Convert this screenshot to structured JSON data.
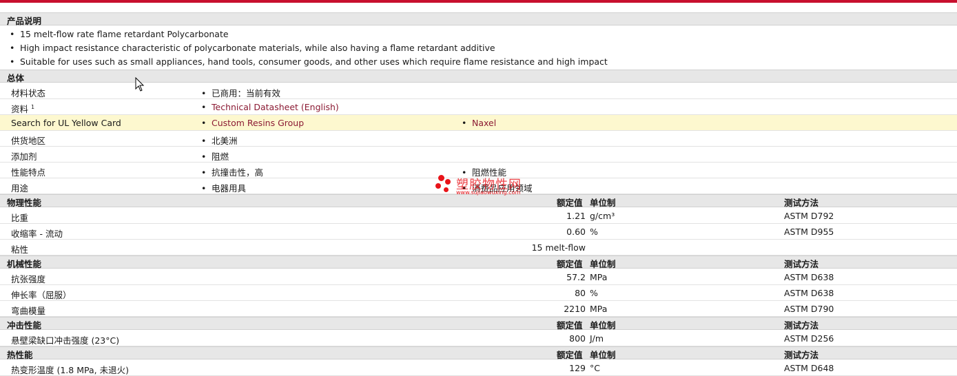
{
  "description": {
    "title": "产品说明",
    "bullets": [
      "15 melt-flow rate flame retardant Polycarbonate",
      "High impact resistance characteristic of polycarbonate materials, while also having a flame retardant additive",
      "Suitable for uses such as small appliances, hand tools, consumer goods, and other uses which require flame resistance and high impact"
    ]
  },
  "general": {
    "title": "总体",
    "rows": [
      {
        "label": "材料状态",
        "values": [
          "已商用：当前有效"
        ]
      },
      {
        "label": "资料",
        "sup": "1",
        "values": [
          "Technical Datasheet (English)"
        ]
      },
      {
        "label": "Search for UL Yellow Card",
        "values": [
          "Custom Resins Group",
          "Naxel"
        ]
      },
      {
        "label": "供货地区",
        "values": [
          "北美洲"
        ]
      },
      {
        "label": "添加剂",
        "values": [
          "阻燃"
        ]
      },
      {
        "label": "性能特点",
        "values": [
          "抗撞击性，高",
          "阻燃性能"
        ]
      },
      {
        "label": "用途",
        "values": [
          "电器用具",
          "消费品应用领域"
        ]
      }
    ]
  },
  "headers": {
    "nominal": "额定值",
    "unit": "单位制",
    "method": "测试方法"
  },
  "physical": {
    "title": "物理性能",
    "rows": [
      {
        "label": "比重",
        "value": "1.21",
        "unit": "g/cm³",
        "method": "ASTM D792"
      },
      {
        "label": "收缩率 - 流动",
        "value": "0.60",
        "unit": "%",
        "method": "ASTM D955"
      },
      {
        "label": "粘性",
        "value": "15 melt-flow",
        "unit": "",
        "method": ""
      }
    ]
  },
  "mechanical": {
    "title": "机械性能",
    "rows": [
      {
        "label": "抗张强度",
        "value": "57.2",
        "unit": "MPa",
        "method": "ASTM D638"
      },
      {
        "label": "伸长率（屈服）",
        "value": "80",
        "unit": "%",
        "method": "ASTM D638"
      },
      {
        "label": "弯曲模量",
        "value": "2210",
        "unit": "MPa",
        "method": "ASTM D790"
      }
    ]
  },
  "impact": {
    "title": "冲击性能",
    "rows": [
      {
        "label": "悬壁梁缺口冲击强度 (23°C)",
        "value": "800",
        "unit": "J/m",
        "method": "ASTM D256"
      }
    ]
  },
  "thermal": {
    "title": "热性能",
    "rows": [
      {
        "label": "热变形温度 (1.8 MPa, 未退火)",
        "value": "129",
        "unit": "°C",
        "method": "ASTM D648"
      }
    ]
  },
  "watermark": {
    "name": "塑胶物性网",
    "url": "www.sujiaowuxing.com"
  },
  "colors": {
    "accent": "#c8102e",
    "link": "#8b1a33",
    "highlight": "#fdf8cf"
  }
}
